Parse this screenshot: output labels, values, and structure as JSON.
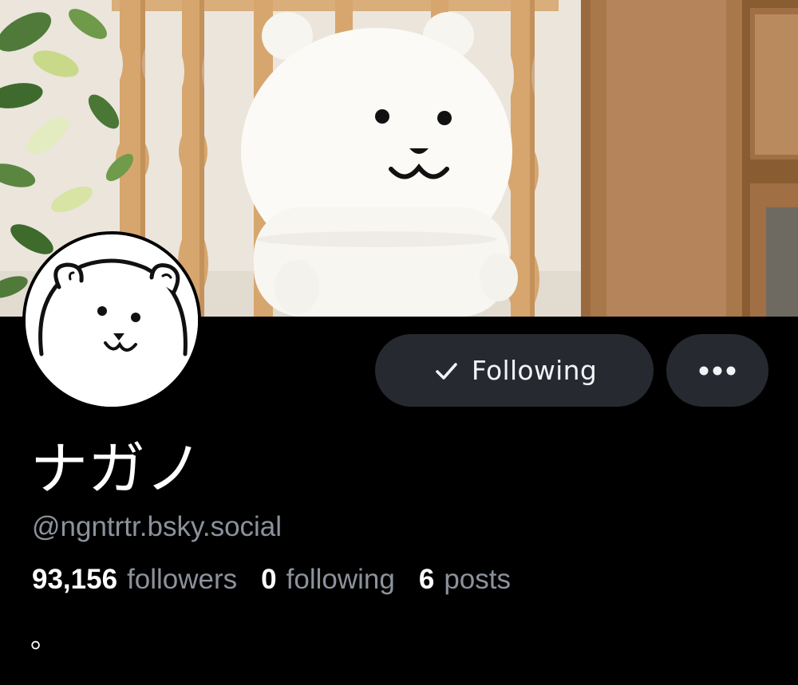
{
  "profile": {
    "display_name": "ナガノ",
    "handle": "@ngntrtr.bsky.social",
    "bio": "。"
  },
  "actions": {
    "follow_label": "Following",
    "follow_icon": "check-icon",
    "more_icon": "ellipsis-icon"
  },
  "stats": {
    "followers_count": "93,156",
    "followers_label": "followers",
    "following_count": "0",
    "following_label": "following",
    "posts_count": "6",
    "posts_label": "posts"
  },
  "colors": {
    "background": "#000000",
    "button_bg": "#26292f",
    "primary_text": "#ffffff",
    "secondary_text": "#8c929c"
  }
}
